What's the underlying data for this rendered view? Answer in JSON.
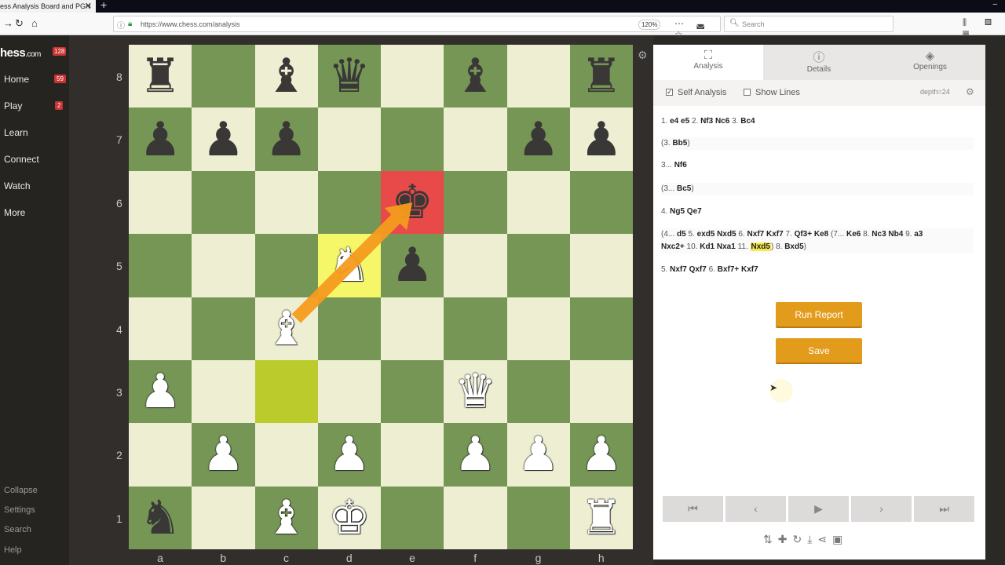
{
  "browser": {
    "tab_title": "ess Analysis Board and PGN",
    "url": "https://www.chess.com/analysis",
    "zoom": "120%",
    "search_placeholder": "Search"
  },
  "sidebar": {
    "logo_main": "hess",
    "logo_suffix": ".com",
    "logo_badge": "128",
    "items": [
      {
        "label": "Home",
        "badge": "59"
      },
      {
        "label": "Play",
        "badge": "2"
      },
      {
        "label": "Learn"
      },
      {
        "label": "Connect"
      },
      {
        "label": "Watch"
      },
      {
        "label": "More"
      }
    ],
    "footer": [
      "Collapse",
      "Settings",
      "Search",
      "Help"
    ]
  },
  "board": {
    "ranks": [
      "8",
      "7",
      "6",
      "5",
      "4",
      "3",
      "2",
      "1"
    ],
    "files": [
      "a",
      "b",
      "c",
      "d",
      "e",
      "f",
      "g",
      "h"
    ],
    "pieces": {
      "a8": "b:♜",
      "c8": "b:♝",
      "d8": "b:♛",
      "f8": "b:♝",
      "h8": "b:♜",
      "a7": "b:♟",
      "b7": "b:♟",
      "c7": "b:♟",
      "g7": "b:♟",
      "h7": "b:♟",
      "e6": "b:♚",
      "d5": "w:♞",
      "e5": "b:♟",
      "c4": "w:♝",
      "a3": "w:♟",
      "f3": "w:♛",
      "b2": "w:♟",
      "d2": "w:♟",
      "f2": "w:♟",
      "g2": "w:♟",
      "h2": "w:♟",
      "a1": "b:♞",
      "c1": "w:♝",
      "d1": "w:♚",
      "h1": "w:♜"
    },
    "highlight": [
      "d5"
    ],
    "highlight_alt": [
      "c3"
    ],
    "check": [
      "e6"
    ],
    "arrow": {
      "from": "c4",
      "to": "e6",
      "color": "#f49b1c"
    }
  },
  "panel": {
    "tabs": [
      {
        "label": "Analysis",
        "icon": "analysis-icon"
      },
      {
        "label": "Details",
        "icon": "info-icon"
      },
      {
        "label": "Openings",
        "icon": "book-icon"
      }
    ],
    "self_analysis": "Self Analysis",
    "show_lines": "Show Lines",
    "depth": "depth=24",
    "moves": [
      {
        "num": "1.",
        "a": "e4 e5",
        "n2": "2.",
        "b": "Nf3 Nc6",
        "n3": "3.",
        "c": "Bc4"
      },
      {
        "text": "(3. ",
        "m": "Bb5",
        "end": ")"
      },
      {
        "num": "3...",
        "a": "Nf6"
      },
      {
        "text": "(3... ",
        "m": "Bc5",
        "end": ")"
      },
      {
        "num": "4.",
        "a": "Ng5 Qe7"
      },
      {
        "v1": "(4... ",
        "v2": "d5",
        "v3": " 5. ",
        "v4": "exd5 Nxd5",
        "v5": " 6. ",
        "v6": "Nxf7 Kxf7",
        "v7": " 7. ",
        "v8": "Qf3+ Ke8",
        "v9": " (7... ",
        "v10": "Ke6",
        "v11": " 8. ",
        "v12": "Nc3 Nb4",
        "v13": " 9. ",
        "v14": "a3",
        "l2a": "Nxc2+",
        "l2b": " 10. ",
        "l2c": "Kd1 Nxa1",
        "l2d": " 11. ",
        "l2e": "Nxd5",
        "l2f": ") 8. ",
        "l2g": "Bxd5",
        "l2h": ")"
      },
      {
        "num": "5.",
        "a": "Nxf7 Qxf7",
        "n2": "6.",
        "b": "Bxf7+ Kxf7"
      }
    ],
    "run_report": "Run Report",
    "save": "Save",
    "controls": [
      "⏮",
      "‹",
      "▶",
      "›",
      "⏭"
    ]
  }
}
